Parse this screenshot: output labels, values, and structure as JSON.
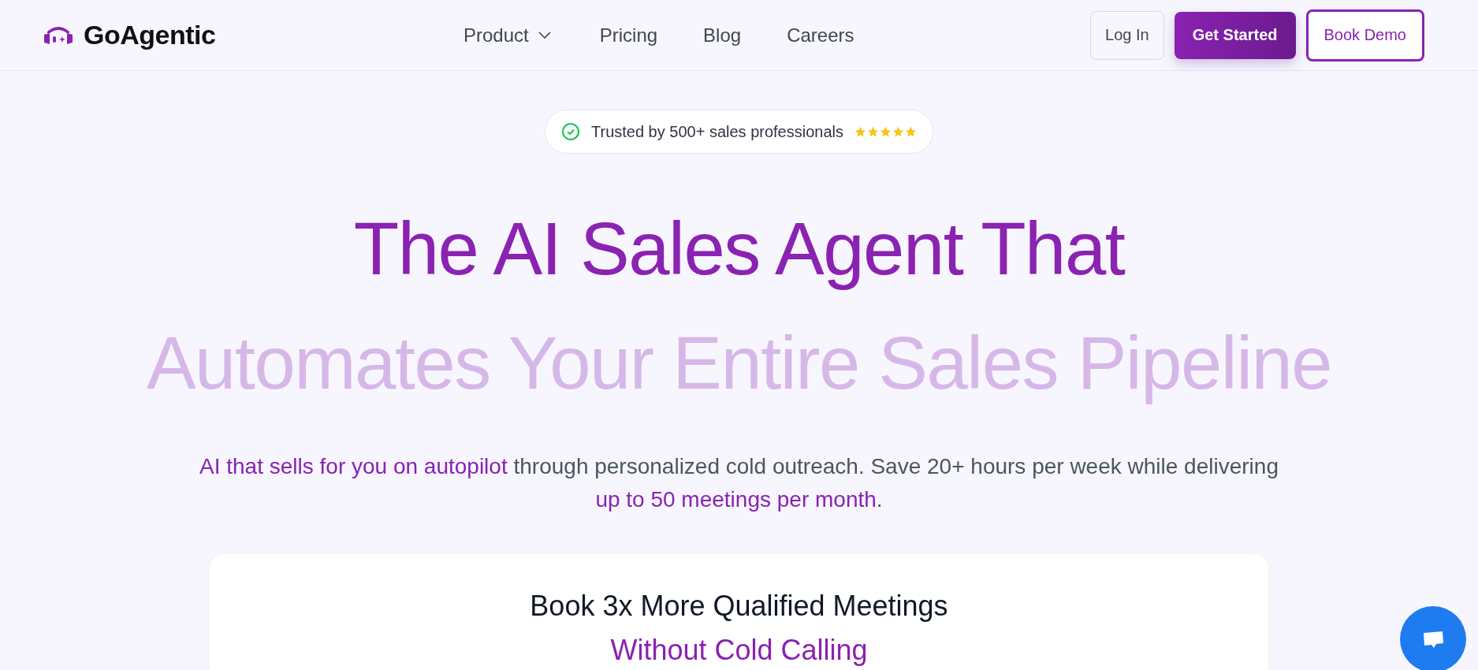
{
  "header": {
    "logo": "GoAgentic",
    "nav": [
      {
        "label": "Product",
        "has_menu": true
      },
      {
        "label": "Pricing",
        "has_menu": false
      },
      {
        "label": "Blog",
        "has_menu": false
      },
      {
        "label": "Careers",
        "has_menu": false
      }
    ],
    "buttons": [
      {
        "label": "Log In",
        "kind": "outline"
      },
      {
        "label": "Get Started",
        "kind": "primary"
      },
      {
        "label": "Book Demo",
        "kind": "secondary"
      }
    ]
  },
  "hero": {
    "badge": {
      "text": "Trusted by 500+ sales professionals",
      "stars": 5
    },
    "headline": [
      {
        "text": "The AI Sales Agent That",
        "faded": false
      },
      {
        "text": "Automates Your Entire Sales Pipeline",
        "faded": true
      }
    ],
    "subtitle": [
      {
        "text": "AI that sells for you on autopilot",
        "highlight": true
      },
      {
        "text": " through personalized cold outreach. Save 20+ hours per week while delivering ",
        "highlight": false
      },
      {
        "text": "up to 50 meetings per month",
        "highlight": true
      },
      {
        "text": ".",
        "highlight": false
      }
    ]
  },
  "card": {
    "title": [
      {
        "text": "Book 3x More Qualified Meetings",
        "accent": false
      },
      {
        "text": "Without Cold Calling",
        "accent": true
      }
    ]
  }
}
